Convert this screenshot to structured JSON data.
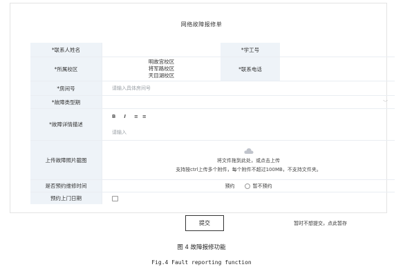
{
  "form": {
    "title": "网络故障报修单",
    "contact_label": "*联系人姓名",
    "id_label": "*学工号",
    "campus_label": "*所属校区",
    "campuses": [
      "明故宫校区",
      "将军路校区",
      "天目湖校区"
    ],
    "phone_label": "*联系电话",
    "room_label": "*房间号",
    "room_placeholder": "请输入具体房间号",
    "type_label": "*故障类型期",
    "desc_label": "*故障详情描述",
    "editor_tools": [
      "B",
      "I",
      "≡",
      "≡"
    ],
    "desc_placeholder": "请输入",
    "upload_label": "上传故障照片截图",
    "upload_hint1": "将文件拖到此处，或点击上传",
    "upload_hint2": "支持按ctrl上传多个附件，每个附件不超过100MB，不支持文件夹。",
    "reserve_label": "是否预约维修时间",
    "reserve_options": [
      "预约",
      "暂不预约"
    ],
    "date_label": "预约上门日期"
  },
  "actions": {
    "submit": "提交",
    "draft": "暂时不想提交，点此暂存"
  },
  "captions": {
    "cn": "图 4 故障报修功能",
    "en": "Fig.4 Fault reporting function"
  },
  "colors": {
    "label_bg": "#eef3f8",
    "border": "#e9edf2"
  }
}
